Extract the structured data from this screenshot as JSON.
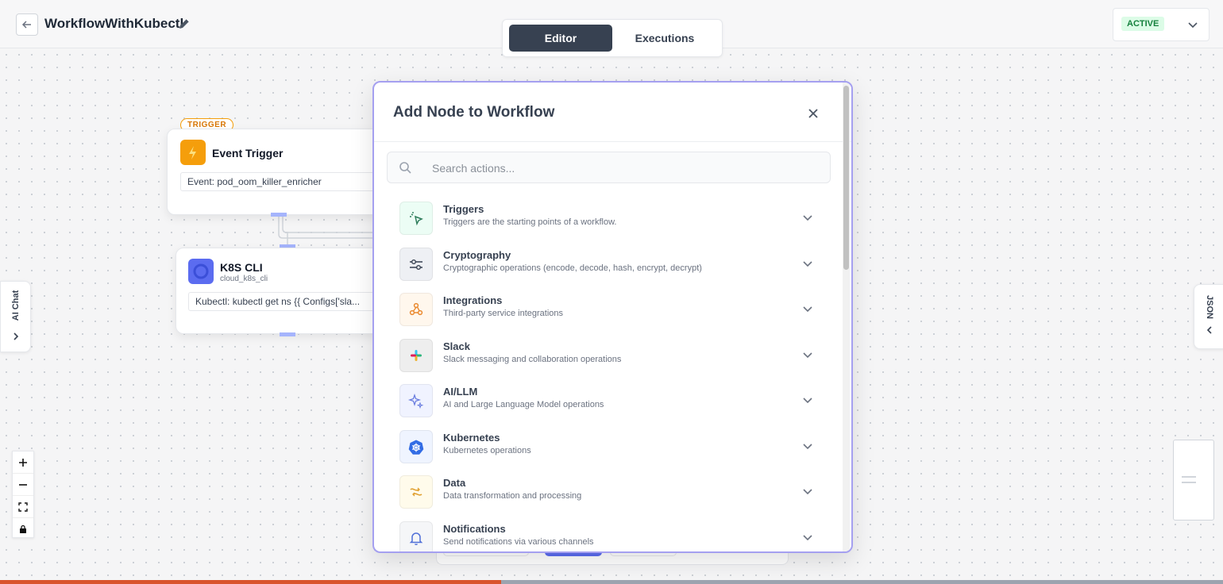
{
  "workflow": {
    "title": "WorkflowWithKubectl",
    "status": "ACTIVE"
  },
  "tabs": {
    "editor": "Editor",
    "executions": "Executions"
  },
  "nodes": {
    "trigger": {
      "tag": "TRIGGER",
      "title": "Event Trigger",
      "field": "Event: pod_oom_killer_enricher"
    },
    "k8s": {
      "title": "K8S CLI",
      "subtitle": "cloud_k8s_cli",
      "field": "Kubectl: kubectl get ns {{ Configs['sla..."
    }
  },
  "side_panels": {
    "left": "AI Chat",
    "right": "JSON"
  },
  "modal": {
    "title": "Add Node to Workflow",
    "search_placeholder": "Search actions...",
    "categories": [
      {
        "name": "Triggers",
        "desc": "Triggers are the starting points of a workflow.",
        "icon": "cursor-click-icon",
        "bg": "#ecfdf5"
      },
      {
        "name": "Cryptography",
        "desc": "Cryptographic operations (encode, decode, hash, encrypt, decrypt)",
        "icon": "sliders-icon",
        "bg": "#eef0f4"
      },
      {
        "name": "Integrations",
        "desc": "Third-party service integrations",
        "icon": "webhook-icon",
        "bg": "#fff7ed"
      },
      {
        "name": "Slack",
        "desc": "Slack messaging and collaboration operations",
        "icon": "slack-icon",
        "bg": "#eeeeee"
      },
      {
        "name": "AI/LLM",
        "desc": "AI and Large Language Model operations",
        "icon": "sparkles-icon",
        "bg": "#f0f3ff"
      },
      {
        "name": "Kubernetes",
        "desc": "Kubernetes operations",
        "icon": "kubernetes-icon",
        "bg": "#eff4ff"
      },
      {
        "name": "Data",
        "desc": "Data transformation and processing",
        "icon": "data-transform-icon",
        "bg": "#fffbeb"
      },
      {
        "name": "Notifications",
        "desc": "Send notifications via various channels",
        "icon": "bell-icon",
        "bg": "#f5f6f8"
      }
    ]
  },
  "progress": {
    "value": 0.41
  },
  "colors": {
    "accent": "#374151",
    "modal_border": "#a5a0f0",
    "progress": "#d9542d",
    "trigger": "#f59e0b",
    "k8s": "#5b6cf0"
  }
}
